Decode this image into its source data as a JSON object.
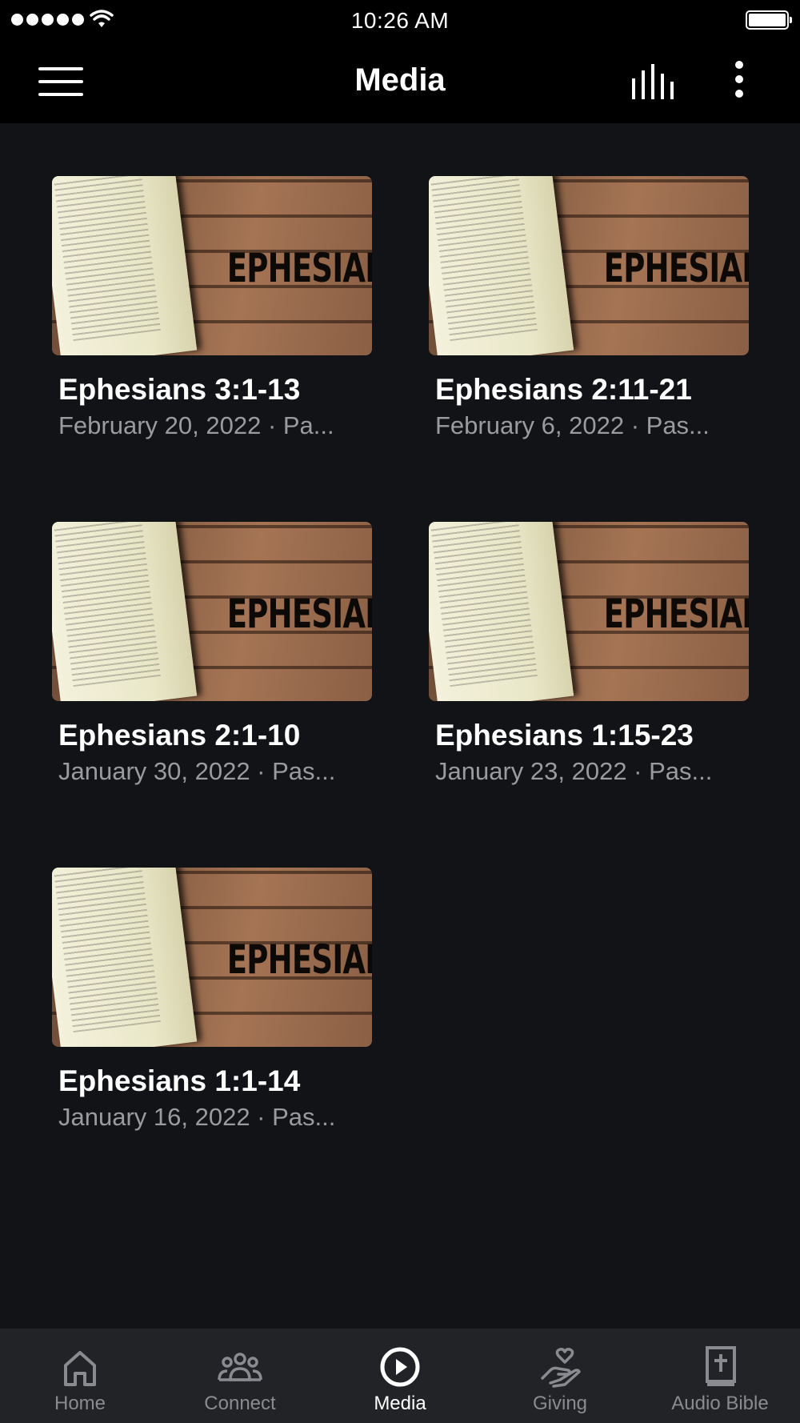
{
  "status_bar": {
    "time": "10:26 AM"
  },
  "nav": {
    "title": "Media"
  },
  "media_items": [
    {
      "title": "Ephesians 3:1-13",
      "subtitle": "February 20, 2022 · Pa...",
      "thumbnail_text": "EPHESIANS"
    },
    {
      "title": "Ephesians 2:11-21",
      "subtitle": "February 6, 2022 · Pas...",
      "thumbnail_text": "EPHESIANS"
    },
    {
      "title": "Ephesians 2:1-10",
      "subtitle": "January 30, 2022 · Pas...",
      "thumbnail_text": "EPHESIANS"
    },
    {
      "title": "Ephesians 1:15-23",
      "subtitle": "January 23, 2022 · Pas...",
      "thumbnail_text": "EPHESIANS"
    },
    {
      "title": "Ephesians 1:1-14",
      "subtitle": "January 16, 2022 · Pas...",
      "thumbnail_text": "EPHESIANS"
    }
  ],
  "tabs": [
    {
      "label": "Home",
      "icon": "home-icon"
    },
    {
      "label": "Connect",
      "icon": "people-icon"
    },
    {
      "label": "Media",
      "icon": "play-circle-icon",
      "active": true
    },
    {
      "label": "Giving",
      "icon": "giving-hand-heart-icon"
    },
    {
      "label": "Audio Bible",
      "icon": "bible-cross-icon"
    }
  ],
  "colors": {
    "background": "#121316",
    "bars": "#000000",
    "tab_bar": "#222327",
    "tab_inactive": "#8a8b90",
    "tab_active": "#ffffff",
    "subtitle": "#9a9ba0"
  }
}
